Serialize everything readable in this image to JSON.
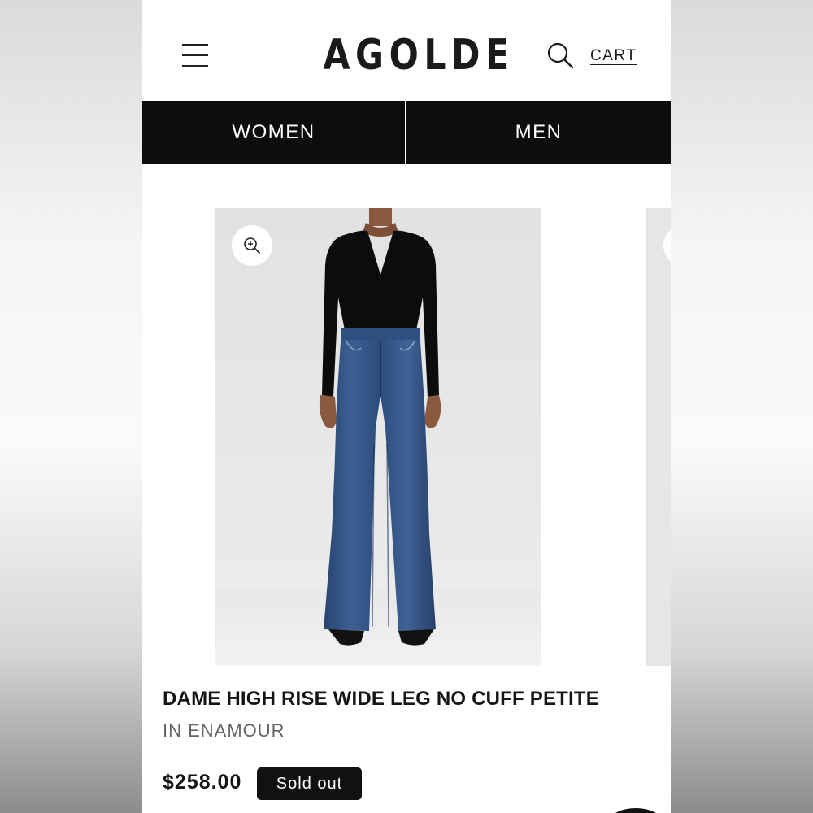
{
  "header": {
    "logo": "AGOLDE",
    "menu_icon": "hamburger-menu-icon",
    "search_icon": "search-icon",
    "cart_label": "CART"
  },
  "nav": {
    "women_label": "WOMEN",
    "men_label": "MEN"
  },
  "product": {
    "zoom_icon": "zoom-in-icon",
    "title": "DAME HIGH RISE WIDE LEG NO CUFF PETITE",
    "color": "IN ENAMOUR",
    "price": "$258.00",
    "status_badge": "Sold out"
  },
  "colors": {
    "background": "#ffffff",
    "nav_background": "#0d0d0d",
    "text": "#151515",
    "muted_text": "#666666",
    "badge_background": "#111111"
  }
}
